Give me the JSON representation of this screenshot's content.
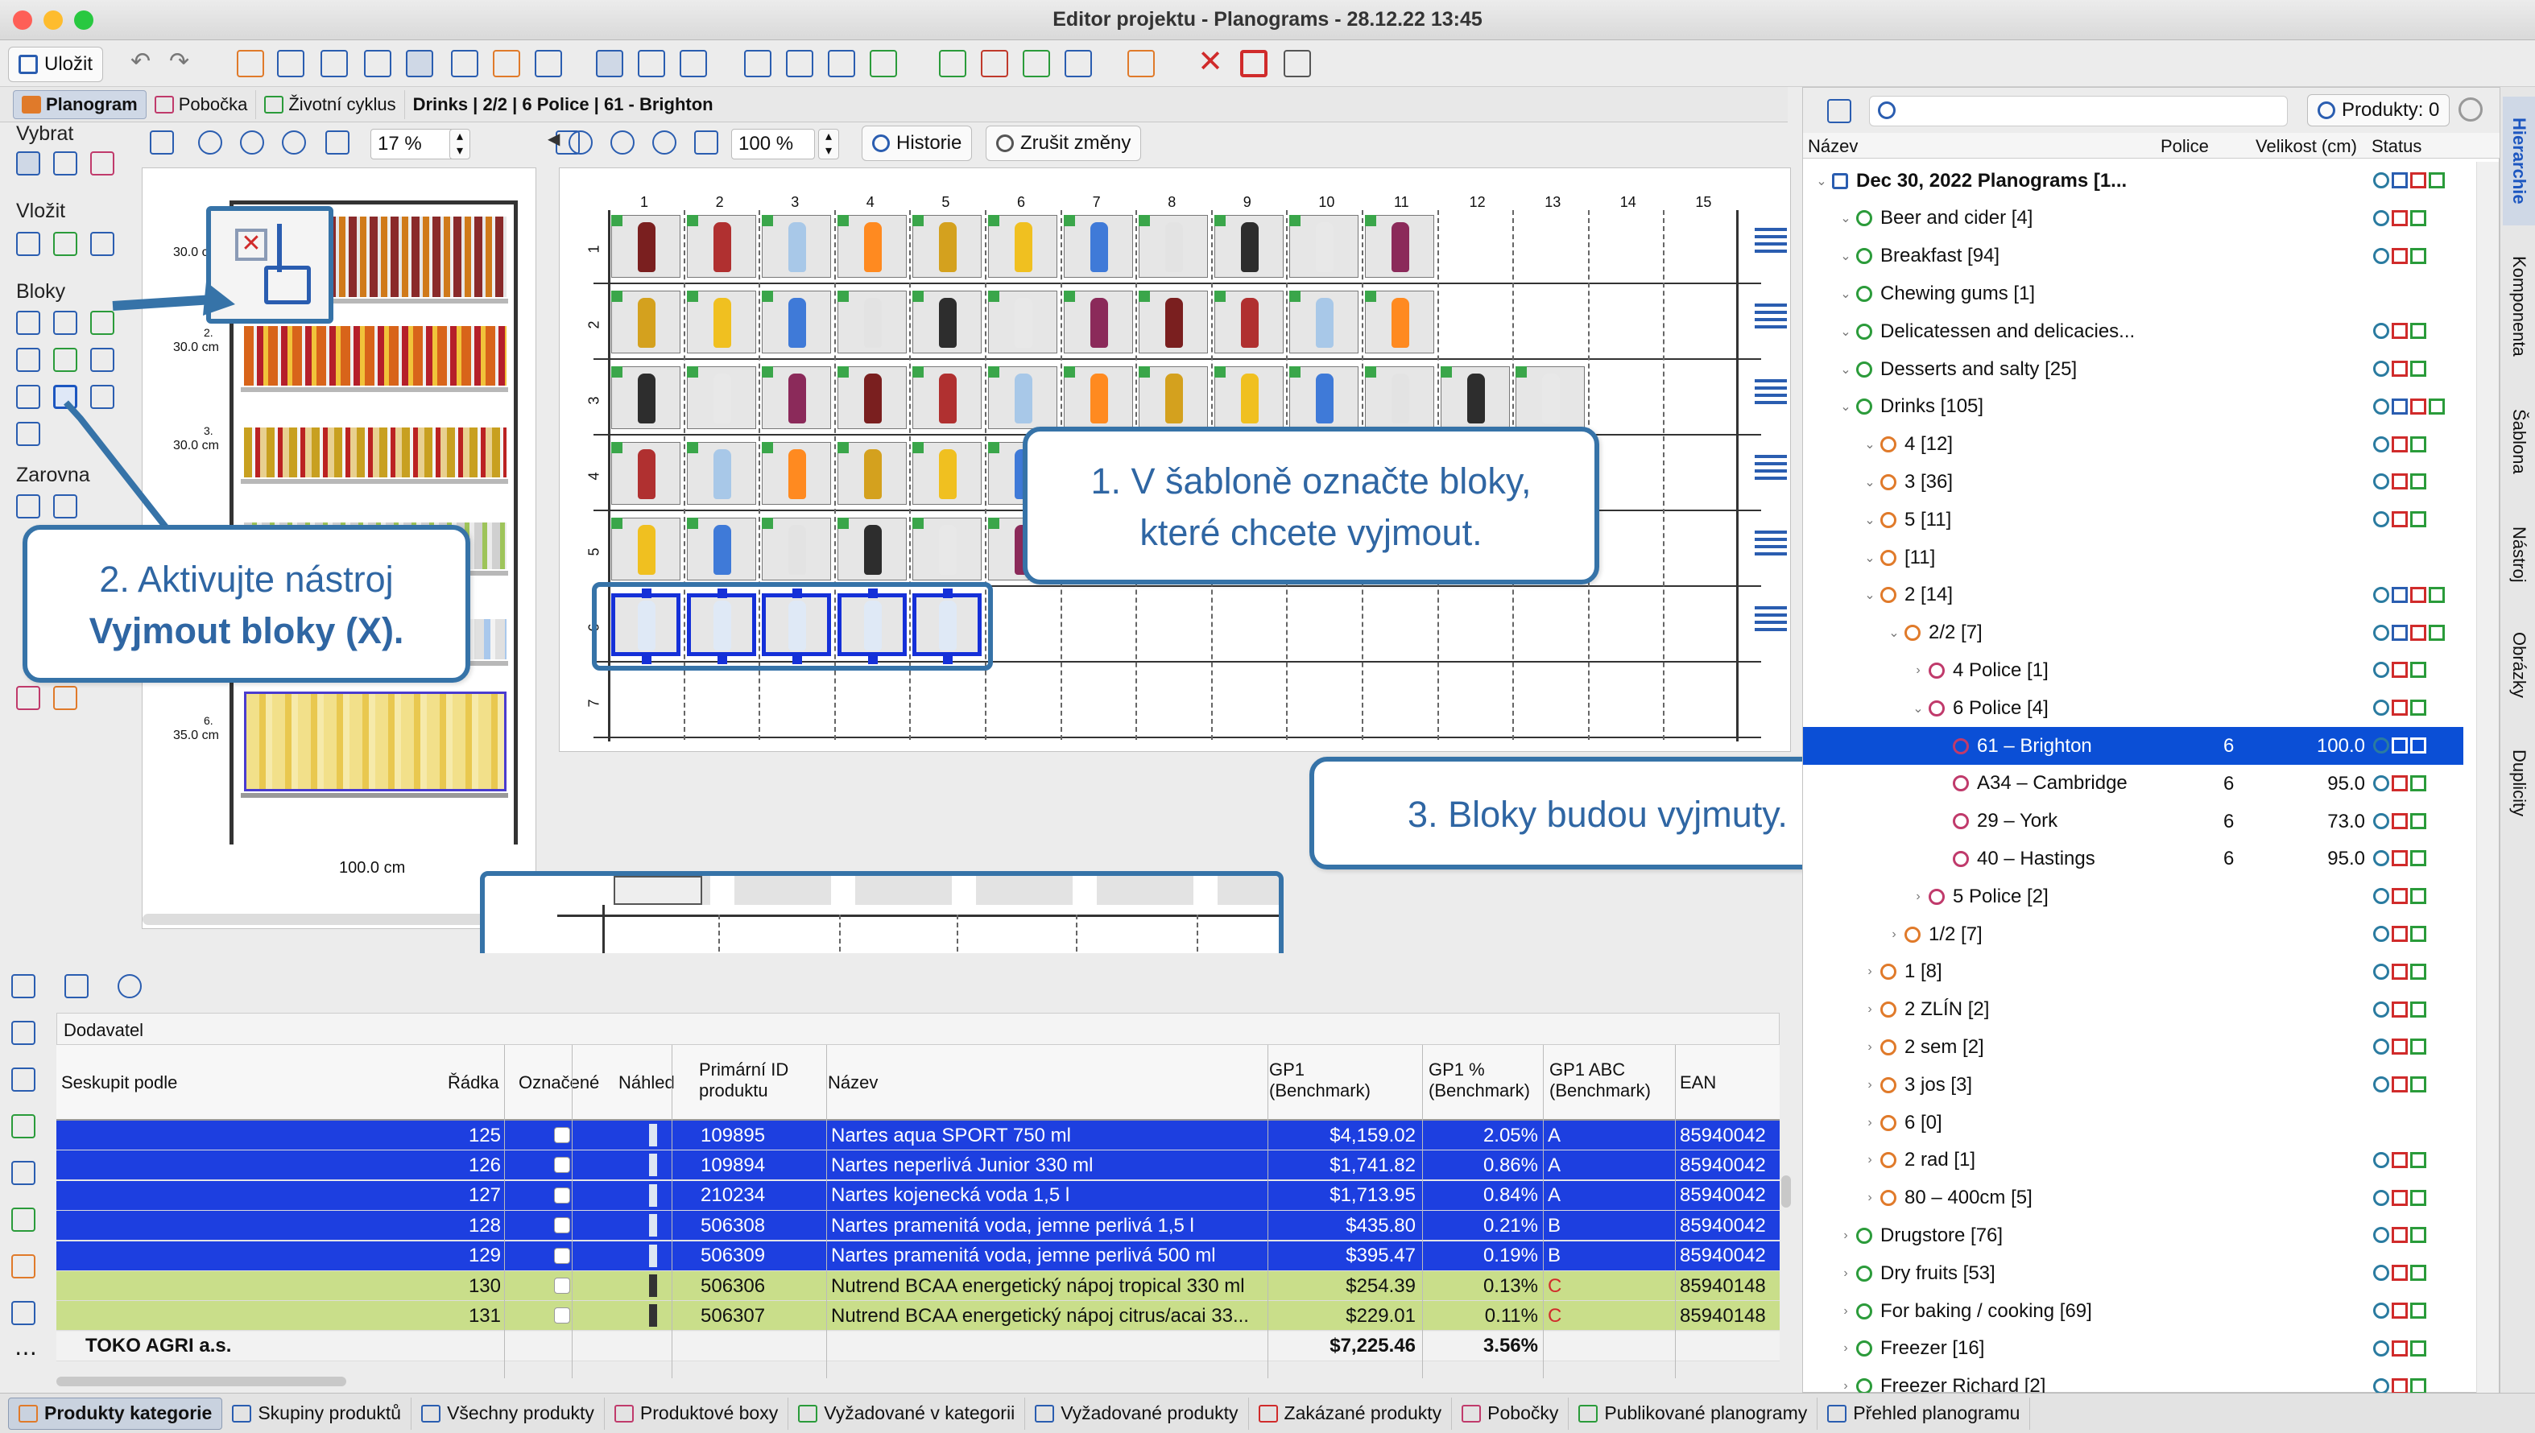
{
  "window": {
    "title": "Editor projektu - Planograms - 28.12.22 13:45"
  },
  "toolbar": {
    "save_label": "Uložit"
  },
  "tabs": {
    "planogram": "Planogram",
    "branch": "Pobočka",
    "lifecycle": "Životní cyklus",
    "breadcrumb": "Drinks | 2/2 | 6 Police | 61 - Brighton"
  },
  "left_panel": {
    "zoom": "17 %",
    "groups": {
      "select": "Vybrat",
      "insert": "Vložit",
      "blocks": "Bloky",
      "align": "Zarovna"
    },
    "shelf_labels": [
      "30.0 cm",
      "30.0 cm",
      "30.0 cm",
      "35.0 cm"
    ],
    "shelf_numbers": [
      "2.",
      "3.",
      "6."
    ],
    "width_label": "100.0 cm"
  },
  "center_panel": {
    "zoom": "100 %",
    "history_label": "Historie",
    "undo_label": "Zrušit změny",
    "columns": [
      "1",
      "2",
      "3",
      "4",
      "5",
      "6",
      "7",
      "8",
      "9",
      "10",
      "11",
      "12",
      "13",
      "14",
      "15"
    ],
    "rows": [
      "1",
      "2",
      "3",
      "4",
      "5",
      "6",
      "7"
    ],
    "zoom_row_label": "6"
  },
  "callouts": {
    "c1_line1": "1. V šabloně označte bloky,",
    "c1_line2": "které chcete vyjmout.",
    "c2_line1": "2. Aktivujte nástroj",
    "c2_line2": "Vyjmout bloky (X).",
    "c3": "3. Bloky budou vyjmuty."
  },
  "right_panel": {
    "products_count": "Produkty: 0",
    "headers": {
      "name": "Název",
      "shelves": "Police",
      "size": "Velikost (cm)",
      "status": "Status"
    },
    "tree": [
      {
        "label": "Dec 30, 2022 Planograms [1...",
        "level": 0,
        "bold": true,
        "police": "",
        "size": ""
      },
      {
        "label": "Beer and cider [4]",
        "level": 1,
        "police": "",
        "size": ""
      },
      {
        "label": "Breakfast [94]",
        "level": 1,
        "police": "",
        "size": ""
      },
      {
        "label": "Chewing gums [1]",
        "level": 1,
        "police": "",
        "size": ""
      },
      {
        "label": "Delicatessen and delicacies...",
        "level": 1,
        "police": "",
        "size": ""
      },
      {
        "label": "Desserts and salty [25]",
        "level": 1,
        "police": "",
        "size": ""
      },
      {
        "label": "Drinks [105]",
        "level": 1,
        "police": "",
        "size": ""
      },
      {
        "label": "4 [12]",
        "level": 2,
        "police": "",
        "size": ""
      },
      {
        "label": "3 [36]",
        "level": 2,
        "police": "",
        "size": ""
      },
      {
        "label": "5 [11]",
        "level": 2,
        "police": "",
        "size": ""
      },
      {
        "label": " [11]",
        "level": 2,
        "police": "",
        "size": ""
      },
      {
        "label": "2 [14]",
        "level": 2,
        "police": "",
        "size": ""
      },
      {
        "label": "2/2 [7]",
        "level": 3,
        "police": "",
        "size": ""
      },
      {
        "label": "4 Police [1]",
        "level": 4,
        "police": "",
        "size": ""
      },
      {
        "label": "6 Police [4]",
        "level": 4,
        "police": "",
        "size": ""
      },
      {
        "label": "61 – Brighton",
        "level": 5,
        "police": "6",
        "size": "100.0",
        "selected": true
      },
      {
        "label": "A34 – Cambridge",
        "level": 5,
        "police": "6",
        "size": "95.0"
      },
      {
        "label": "29 – York",
        "level": 5,
        "police": "6",
        "size": "73.0"
      },
      {
        "label": "40 – Hastings",
        "level": 5,
        "police": "6",
        "size": "95.0"
      },
      {
        "label": "5 Police [2]",
        "level": 4,
        "police": "",
        "size": ""
      },
      {
        "label": "1/2 [7]",
        "level": 3,
        "police": "",
        "size": ""
      },
      {
        "label": "1 [8]",
        "level": 2,
        "police": "",
        "size": ""
      },
      {
        "label": "2 ZLÍN [2]",
        "level": 2,
        "police": "",
        "size": ""
      },
      {
        "label": "2 sem [2]",
        "level": 2,
        "police": "",
        "size": ""
      },
      {
        "label": "3 jos [3]",
        "level": 2,
        "police": "",
        "size": ""
      },
      {
        "label": "6 [0]",
        "level": 2,
        "police": "",
        "size": ""
      },
      {
        "label": "2 rad [1]",
        "level": 2,
        "police": "",
        "size": ""
      },
      {
        "label": "80 – 400cm [5]",
        "level": 2,
        "police": "",
        "size": ""
      },
      {
        "label": "Drugstore [76]",
        "level": 1,
        "police": "",
        "size": ""
      },
      {
        "label": "Dry fruits [53]",
        "level": 1,
        "police": "",
        "size": ""
      },
      {
        "label": "For baking / cooking [69]",
        "level": 1,
        "police": "",
        "size": ""
      },
      {
        "label": "Freezer [16]",
        "level": 1,
        "police": "",
        "size": ""
      },
      {
        "label": "Freezer Richard [2]",
        "level": 1,
        "police": "",
        "size": ""
      }
    ],
    "vertical_tabs": [
      "Hierarchie",
      "Komponenta",
      "Šablona",
      "Nástroj",
      "Obrázky",
      "Duplicity"
    ]
  },
  "table": {
    "group_field": "Dodavatel",
    "headers": {
      "group": "Seskupit podle",
      "row": "Řádka",
      "marked": "Označené",
      "preview": "Náhled",
      "primary_id": "Primární ID produktu",
      "name": "Název",
      "gp1": "GP1 (Benchmark)",
      "gp1pct": "GP1 % (Benchmark)",
      "gp1abc": "GP1 ABC (Benchmark)",
      "ean": "EAN"
    },
    "rows": [
      {
        "row": "125",
        "id": "109895",
        "name": "Nartes aqua SPORT 750 ml",
        "gp1": "$4,159.02",
        "pct": "2.05%",
        "abc": "A",
        "ean": "85940042",
        "style": "blue"
      },
      {
        "row": "126",
        "id": "109894",
        "name": "Nartes neperlivá Junior 330 ml",
        "gp1": "$1,741.82",
        "pct": "0.86%",
        "abc": "A",
        "ean": "85940042",
        "style": "blue"
      },
      {
        "row": "127",
        "id": "210234",
        "name": "Nartes kojenecká voda 1,5 l",
        "gp1": "$1,713.95",
        "pct": "0.84%",
        "abc": "A",
        "ean": "85940042",
        "style": "blue"
      },
      {
        "row": "128",
        "id": "506308",
        "name": "Nartes pramenitá voda, jemne perlivá 1,5 l",
        "gp1": "$435.80",
        "pct": "0.21%",
        "abc": "B",
        "ean": "85940042",
        "style": "blue"
      },
      {
        "row": "129",
        "id": "506309",
        "name": "Nartes pramenitá voda, jemne perlivá 500 ml",
        "gp1": "$395.47",
        "pct": "0.19%",
        "abc": "B",
        "ean": "85940042",
        "style": "blue"
      },
      {
        "row": "130",
        "id": "506306",
        "name": "Nutrend BCAA energetický nápoj tropical 330 ml",
        "gp1": "$254.39",
        "pct": "0.13%",
        "abc": "C",
        "ean": "85940148",
        "style": "green"
      },
      {
        "row": "131",
        "id": "506307",
        "name": "Nutrend BCAA energetický nápoj citrus/acai 33...",
        "gp1": "$229.01",
        "pct": "0.11%",
        "abc": "C",
        "ean": "85940148",
        "style": "green"
      }
    ],
    "group_row": {
      "label": "TOKO AGRI a.s.",
      "gp1": "$7,225.46",
      "pct": "3.56%"
    }
  },
  "bottom_tabs": [
    "Produkty kategorie",
    "Skupiny produktů",
    "Všechny produkty",
    "Produktové boxy",
    "Vyžadované v kategorii",
    "Vyžadované produkty",
    "Zakázané produkty",
    "Pobočky",
    "Publikované planogramy",
    "Přehled planogramu"
  ],
  "colors": {
    "accent": "#1d3fe0",
    "callout": "#3673a8",
    "green_row": "#c9de8a",
    "selected_row": "#0b4fd6"
  }
}
